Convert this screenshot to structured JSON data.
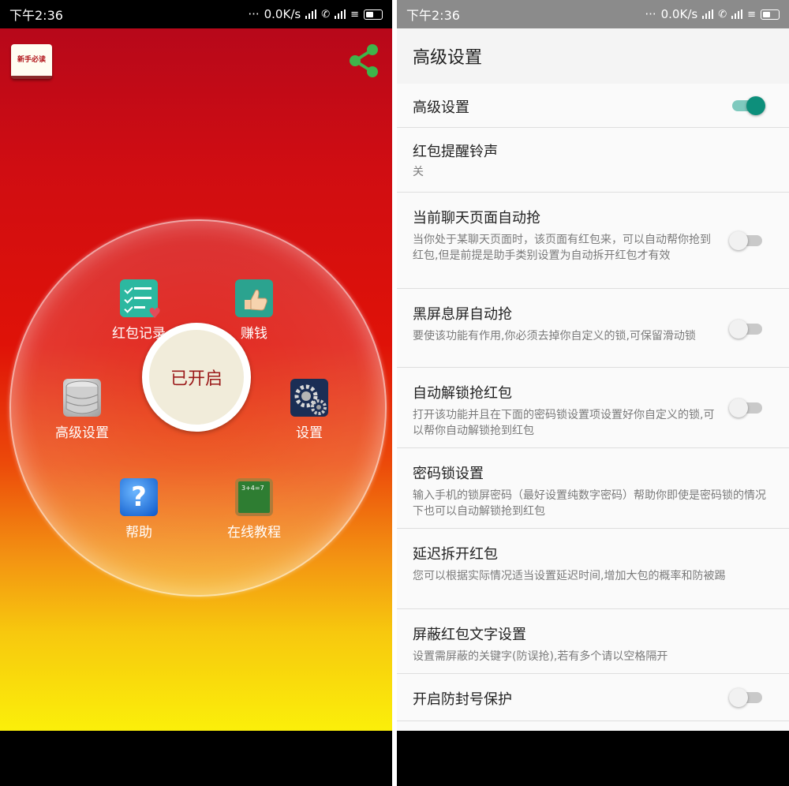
{
  "status": {
    "time": "下午2:36",
    "speed": "0.0K/s",
    "dots": "···"
  },
  "left": {
    "guide_label": "新手必读",
    "center_button": "已开启",
    "menu": {
      "record": "红包记录",
      "money": "赚钱",
      "advanced": "高级设置",
      "settings": "设置",
      "help": "帮助",
      "tutorial": "在线教程"
    },
    "tutorial_board_text": "3+4=7",
    "help_glyph": "?",
    "colors": {
      "top": "#b7081a",
      "bottom": "#fbef0a",
      "share": "#3fb44a"
    }
  },
  "right": {
    "title": "高级设置",
    "settings": [
      {
        "name": "高级设置",
        "desc": "",
        "toggle": "on"
      },
      {
        "name": "红包提醒铃声",
        "desc": "关",
        "toggle": "none"
      },
      {
        "name": "当前聊天页面自动抢",
        "desc": "当你处于某聊天页面时，该页面有红包来，可以自动帮你抢到红包,但是前提是助手类别设置为自动拆开红包才有效",
        "toggle": "off"
      },
      {
        "name": "黑屏息屏自动抢",
        "desc": "要使该功能有作用,你必须去掉你自定义的锁,可保留滑动锁",
        "toggle": "off"
      },
      {
        "name": "自动解锁抢红包",
        "desc": "打开该功能并且在下面的密码锁设置项设置好你自定义的锁,可以帮你自动解锁抢到红包",
        "toggle": "off"
      },
      {
        "name": "密码锁设置",
        "desc": "输入手机的锁屏密码（最好设置纯数字密码）帮助你即使是密码锁的情况下也可以自动解锁抢到红包",
        "toggle": "none"
      },
      {
        "name": "延迟拆开红包",
        "desc": "您可以根据实际情况适当设置延迟时间,增加大包的概率和防被踢",
        "toggle": "none"
      },
      {
        "name": "屏蔽红包文字设置",
        "desc": "设置需屏蔽的关键字(防误抢),若有多个请以空格隔开",
        "toggle": "none"
      },
      {
        "name": "开启防封号保护",
        "desc": "",
        "toggle": "off"
      }
    ]
  }
}
